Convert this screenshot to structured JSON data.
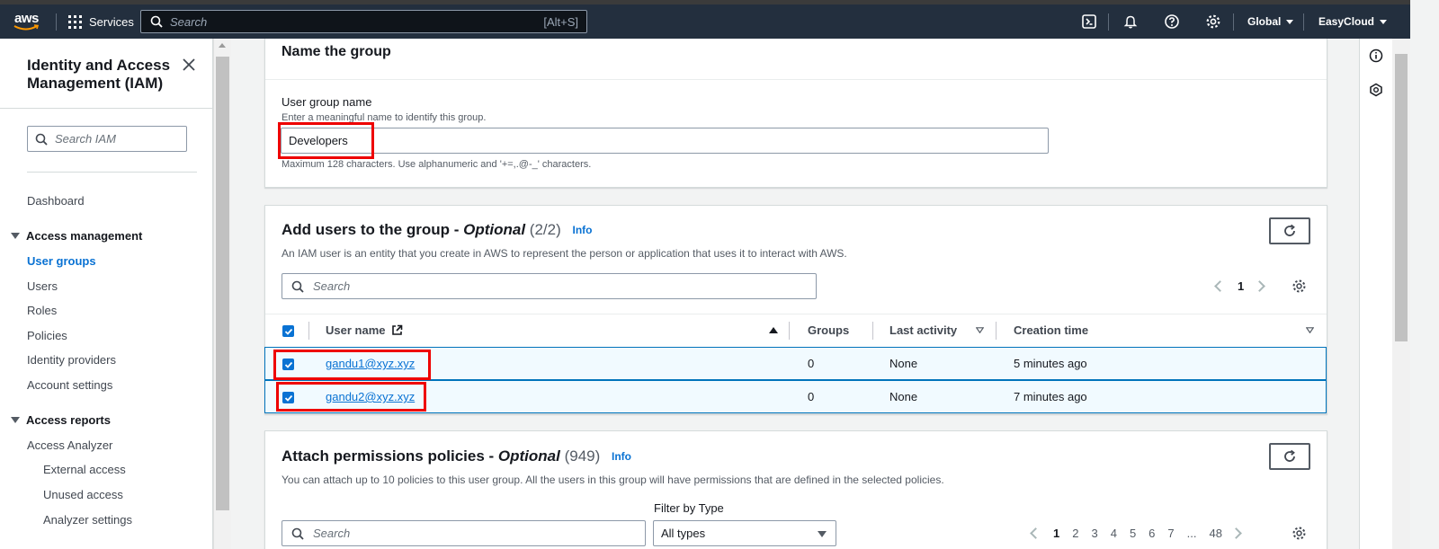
{
  "topnav": {
    "logo_text": "aws",
    "services_label": "Services",
    "search_placeholder": "Search",
    "search_shortcut": "[Alt+S]",
    "region_label": "Global",
    "account_label": "EasyCloud"
  },
  "sidebar": {
    "title": "Identity and Access Management (IAM)",
    "search_placeholder": "Search IAM",
    "dashboard": "Dashboard",
    "section_access_management": "Access management",
    "items": [
      "User groups",
      "Users",
      "Roles",
      "Policies",
      "Identity providers",
      "Account settings"
    ],
    "section_access_reports": "Access reports",
    "reports": [
      "Access Analyzer",
      "External access",
      "Unused access",
      "Analyzer settings"
    ]
  },
  "name_group": {
    "heading": "Name the group",
    "field_label": "User group name",
    "field_description": "Enter a meaningful name to identify this group.",
    "field_value": "Developers",
    "constraint": "Maximum 128 characters. Use alphanumeric and '+=,.@-_' characters."
  },
  "add_users": {
    "heading_main": "Add users to the group - ",
    "heading_optional": "Optional",
    "count": "(2/2)",
    "info": "Info",
    "description": "An IAM user is an entity that you create in AWS to represent the person or application that uses it to interact with AWS.",
    "search_placeholder": "Search",
    "page_current": "1",
    "columns": {
      "username": "User name",
      "groups": "Groups",
      "last_activity": "Last activity",
      "creation_time": "Creation time"
    },
    "rows": [
      {
        "username": "gandu1@xyz.xyz",
        "groups": "0",
        "last_activity": "None",
        "creation_time": "5 minutes ago"
      },
      {
        "username": "gandu2@xyz.xyz",
        "groups": "0",
        "last_activity": "None",
        "creation_time": "7 minutes ago"
      }
    ]
  },
  "attach_policies": {
    "heading_main": "Attach permissions policies - ",
    "heading_optional": "Optional",
    "count": "(949)",
    "info": "Info",
    "description": "You can attach up to 10 policies to this user group. All the users in this group will have permissions that are defined in the selected policies.",
    "filter_label": "Filter by Type",
    "filter_value": "All types",
    "search_placeholder": "Search",
    "pages": [
      "1",
      "2",
      "3",
      "4",
      "5",
      "6",
      "7",
      "...",
      "48"
    ]
  },
  "colors": {
    "nav_bg": "#232f3e",
    "link_blue": "#0972d3",
    "highlight_red": "#ee0000",
    "selected_row_bg": "#f1faff"
  }
}
